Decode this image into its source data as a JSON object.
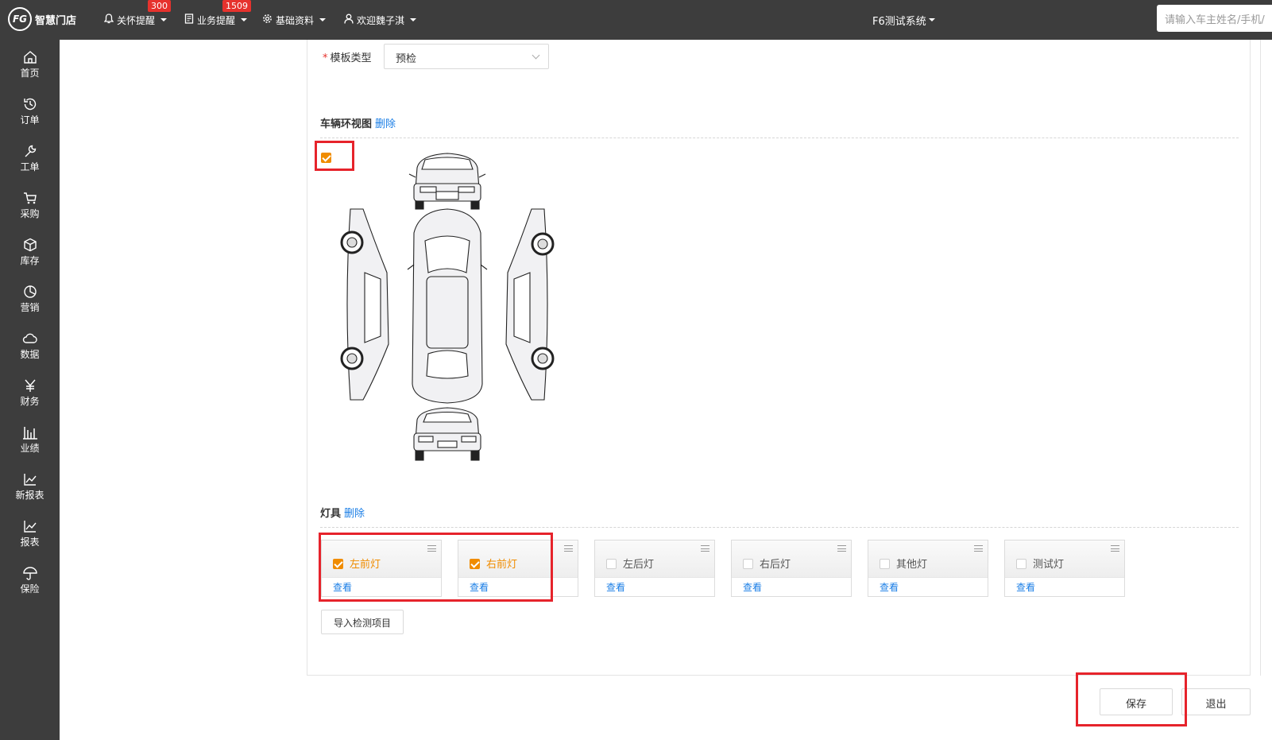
{
  "topbar": {
    "logo_mark": "FG",
    "logo_text": "智慧门店",
    "nav": [
      {
        "label": "关怀提醒",
        "badge": "300"
      },
      {
        "label": "业务提醒",
        "badge": "1509"
      },
      {
        "label": "基础资料",
        "badge": ""
      },
      {
        "label": "欢迎魏子淇",
        "badge": ""
      }
    ],
    "system_name": "F6测试系统",
    "search_placeholder": "请输入车主姓名/手机/"
  },
  "sidebar": {
    "items": [
      {
        "label": "首页",
        "icon": "home-icon"
      },
      {
        "label": "订单",
        "icon": "history-icon"
      },
      {
        "label": "工单",
        "icon": "wrench-icon"
      },
      {
        "label": "采购",
        "icon": "cart-icon"
      },
      {
        "label": "库存",
        "icon": "box-icon"
      },
      {
        "label": "营销",
        "icon": "pie-icon"
      },
      {
        "label": "数据",
        "icon": "cloud-icon"
      },
      {
        "label": "财务",
        "icon": "yen-icon"
      },
      {
        "label": "业绩",
        "icon": "bar-chart-icon"
      },
      {
        "label": "新报表",
        "icon": "line-chart-icon"
      },
      {
        "label": "报表",
        "icon": "line-chart-icon"
      },
      {
        "label": "保险",
        "icon": "umbrella-icon"
      }
    ]
  },
  "form": {
    "template_type_label": "模板类型",
    "template_type_value": "预检"
  },
  "vehicle_section": {
    "title": "车辆环视图",
    "delete_label": "删除",
    "checked": true
  },
  "lamp_section": {
    "title": "灯具",
    "delete_label": "删除",
    "items": [
      {
        "label": "左前灯",
        "checked": true,
        "view": "查看"
      },
      {
        "label": "右前灯",
        "checked": true,
        "view": "查看"
      },
      {
        "label": "左后灯",
        "checked": false,
        "view": "查看"
      },
      {
        "label": "右后灯",
        "checked": false,
        "view": "查看"
      },
      {
        "label": "其他灯",
        "checked": false,
        "view": "查看"
      },
      {
        "label": "测试灯",
        "checked": false,
        "view": "查看"
      }
    ],
    "import_label": "导入检测项目"
  },
  "actions": {
    "save_label": "保存",
    "exit_label": "退出"
  },
  "colors": {
    "topbar": "#3d3d3d",
    "accent_orange": "#f08c00",
    "link_blue": "#1a7ee6",
    "highlight_red": "#e6232b",
    "badge_red": "#e6322d"
  }
}
